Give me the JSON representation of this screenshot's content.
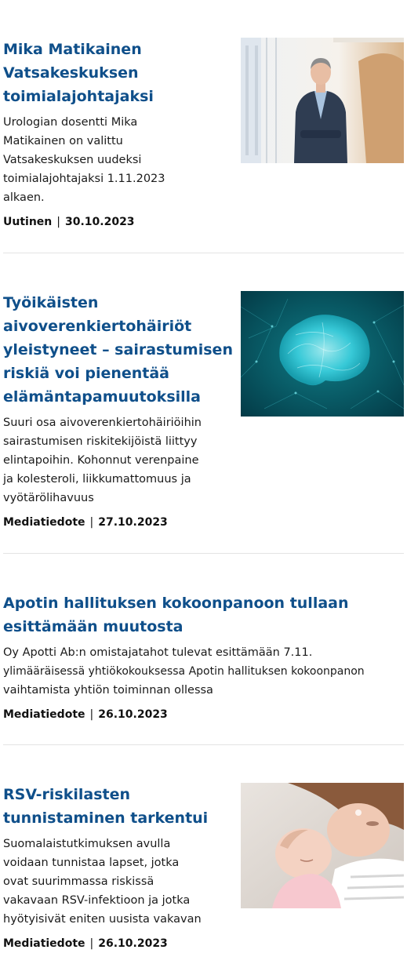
{
  "news": [
    {
      "title_lines": [
        "Mika Matikainen",
        "Vatsakeskuksen",
        "toimialajohtajaksi"
      ],
      "excerpt_lines": [
        "Urologian dosentti Mika",
        "Matikainen on valittu",
        "Vatsakeskuksen uudeksi",
        "toimialajohtajaksi 1.11.2023",
        "alkaen."
      ],
      "type": "Uutinen",
      "separator": "|",
      "date": "30.10.2023",
      "image_icon": "portrait-photo-icon"
    },
    {
      "title_lines": [
        "Työikäisten",
        "aivoverenkiertohäiriöt",
        "yleistyneet – sairastumisen",
        "riskiä voi pienentää",
        "elämäntapamuutoksilla"
      ],
      "excerpt_lines": [
        "Suuri osa aivoverenkiertohäiriöihin",
        "sairastumisen riskitekijöistä liittyy",
        "elintapoihin. Kohonnut verenpaine",
        "ja kolesteroli, liikkumattomuus ja",
        "vyötärölihavuus"
      ],
      "type": "Mediatiedote",
      "separator": "|",
      "date": "27.10.2023",
      "image_icon": "brain-network-icon"
    },
    {
      "title_lines": [
        "Apotin hallituksen kokoonpanoon tullaan",
        "esittämään muutosta"
      ],
      "excerpt_lines": [
        "Oy Apotti Ab:n omistajatahot tulevat esittämään 7.11.",
        "ylimääräisessä yhtiökokouksessa Apotin hallituksen kokoonpanon",
        "vaihtamista yhtiön toiminnan ollessa"
      ],
      "type": "Mediatiedote",
      "separator": "|",
      "date": "26.10.2023"
    },
    {
      "title_lines": [
        "RSV-riskilasten",
        "tunnistaminen tarkentui"
      ],
      "excerpt_lines": [
        "Suomalaistutkimuksen avulla",
        "voidaan tunnistaa lapset, jotka",
        "ovat suurimmassa riskissä",
        "vakavaan RSV-infektioon ja jotka",
        "hyötyisivät eniten uusista vakavan"
      ],
      "type": "Mediatiedote",
      "separator": "|",
      "date": "26.10.2023",
      "image_icon": "mother-baby-photo-icon"
    }
  ],
  "colors": {
    "title": "#0f4f8a",
    "text": "#1a1a1a",
    "divider": "#e3e3e3"
  }
}
